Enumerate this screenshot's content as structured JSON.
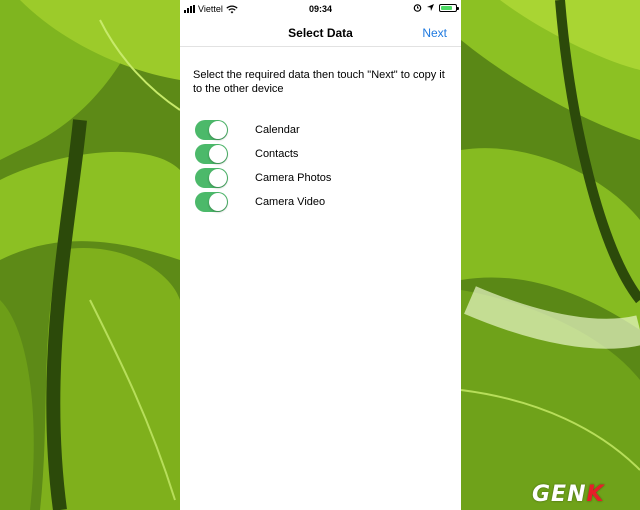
{
  "status_bar": {
    "carrier": "Viettel",
    "time": "09:34"
  },
  "nav": {
    "title": "Select Data",
    "next_label": "Next"
  },
  "instructions": "Select the required data then touch \"Next\" to copy it to the other device",
  "options": [
    {
      "label": "Calendar",
      "enabled": true
    },
    {
      "label": "Contacts",
      "enabled": true
    },
    {
      "label": "Camera Photos",
      "enabled": true
    },
    {
      "label": "Camera Video",
      "enabled": true
    }
  ],
  "colors": {
    "toggle_on": "#4cb96a",
    "link": "#1f7ae0"
  },
  "watermark": {
    "main": "GEN",
    "accent": "K"
  }
}
